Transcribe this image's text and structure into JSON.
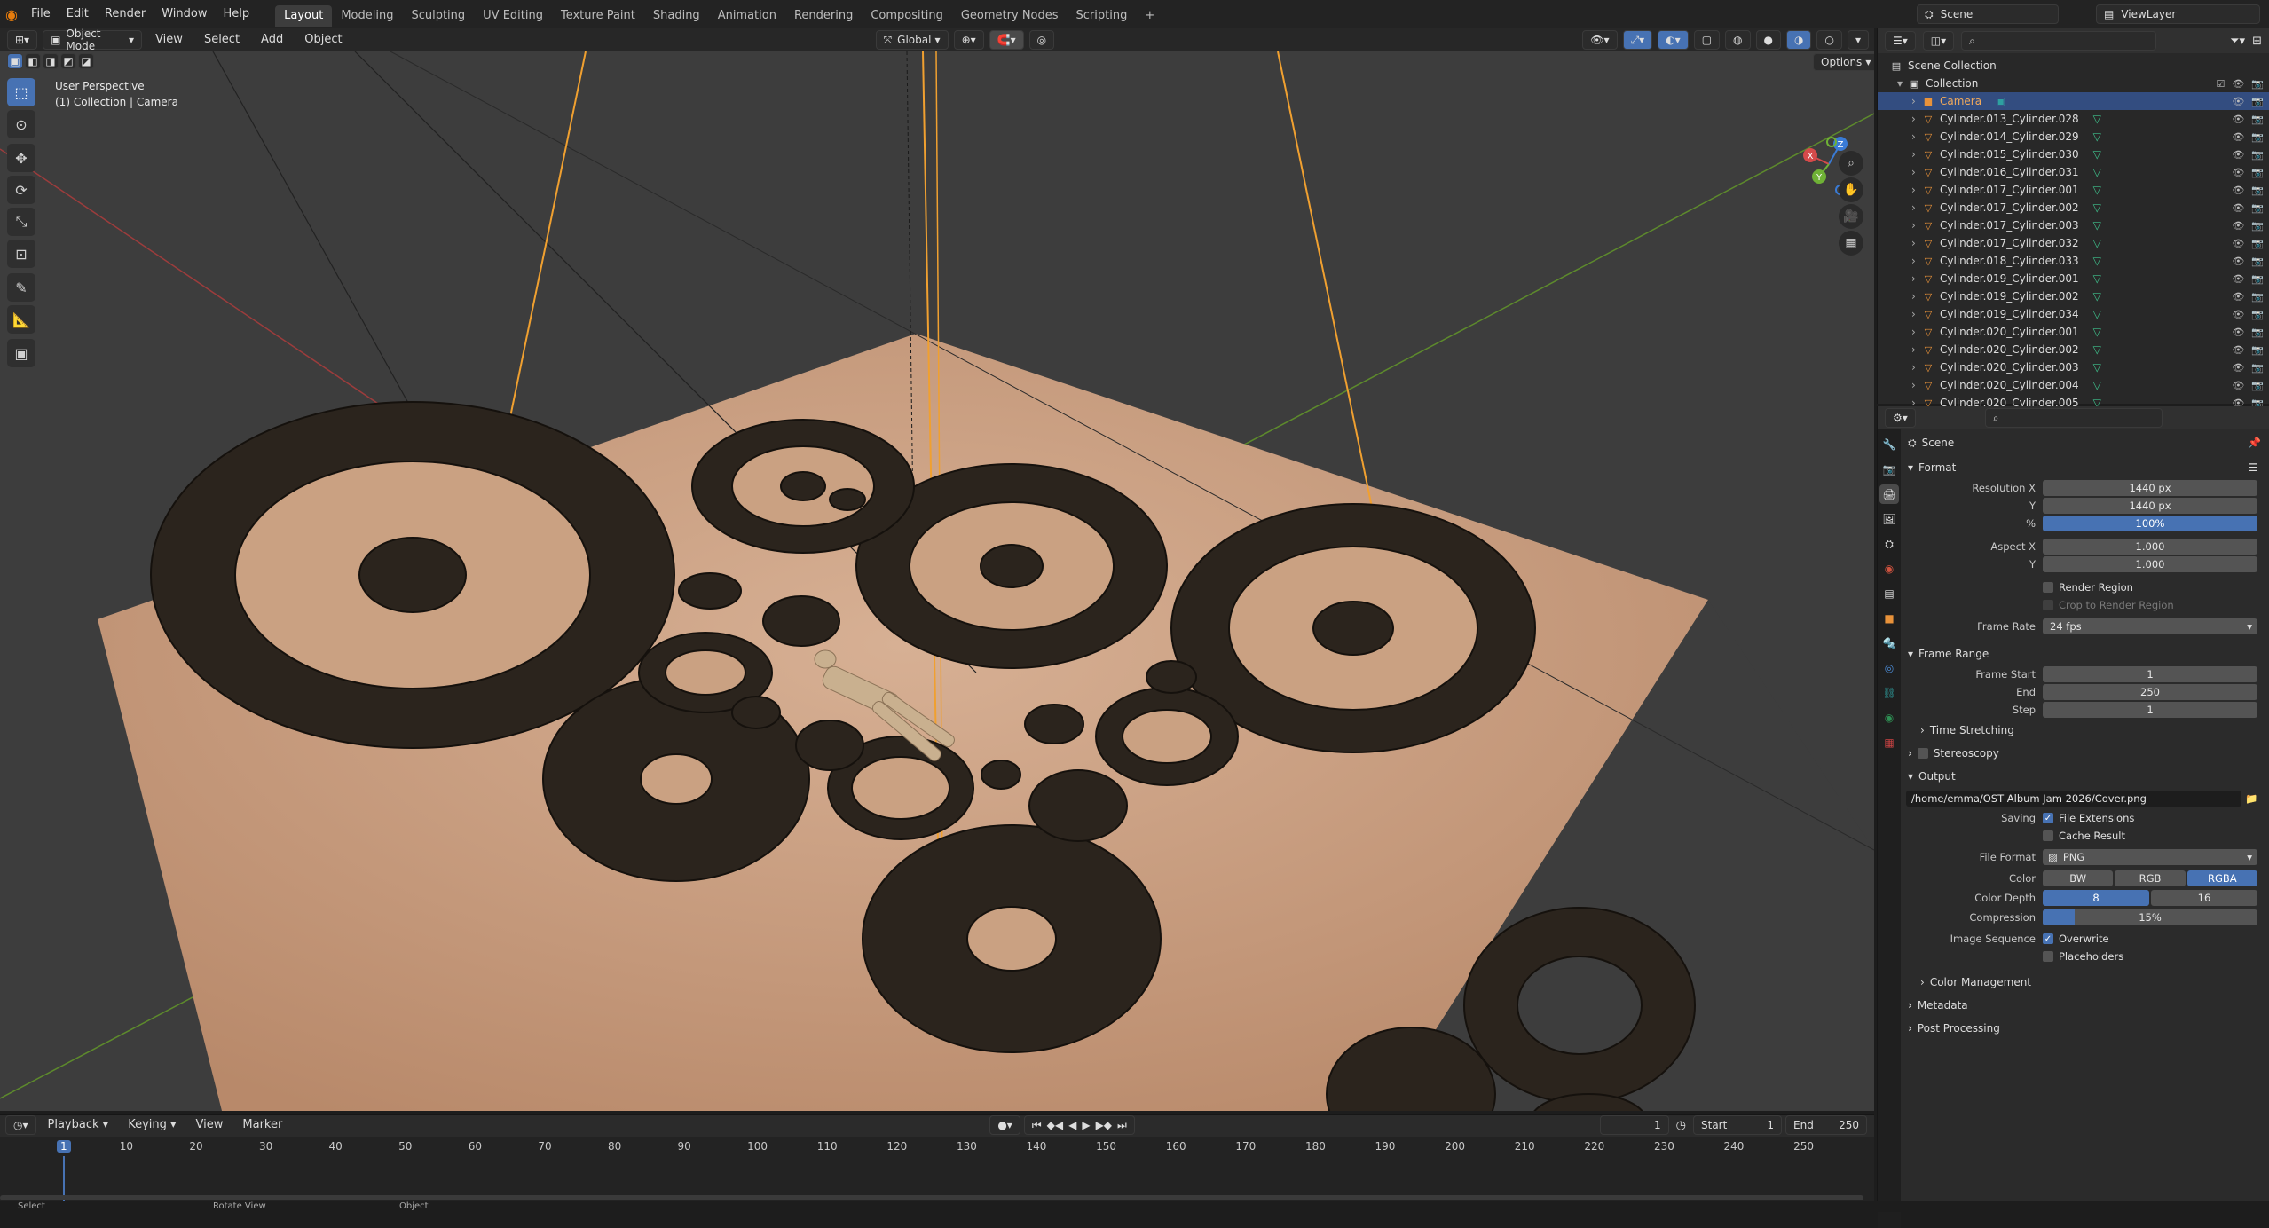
{
  "topbar": {
    "menus": [
      "File",
      "Edit",
      "Render",
      "Window",
      "Help"
    ],
    "workspaces": [
      "Layout",
      "Modeling",
      "Sculpting",
      "UV Editing",
      "Texture Paint",
      "Shading",
      "Animation",
      "Rendering",
      "Compositing",
      "Geometry Nodes",
      "Scripting"
    ],
    "active_workspace": "Layout",
    "scene": "Scene",
    "view_layer": "ViewLayer"
  },
  "viewport_header": {
    "mode": "Object Mode",
    "menus": [
      "View",
      "Select",
      "Add",
      "Object"
    ],
    "transform_orientation": "Global",
    "options_label": "Options"
  },
  "viewport": {
    "perspective": "User Perspective",
    "context": "(1) Collection | Camera",
    "gizmo_axes": [
      "X",
      "Y",
      "Z"
    ],
    "floor_color": "#caa182",
    "gear_color": "#2b241d",
    "accent_line_color": "#f0a030"
  },
  "outliner": {
    "root": "Scene Collection",
    "collection": "Collection",
    "items": [
      "Camera",
      "Cylinder.013_Cylinder.028",
      "Cylinder.014_Cylinder.029",
      "Cylinder.015_Cylinder.030",
      "Cylinder.016_Cylinder.031",
      "Cylinder.017_Cylinder.001",
      "Cylinder.017_Cylinder.002",
      "Cylinder.017_Cylinder.003",
      "Cylinder.017_Cylinder.032",
      "Cylinder.018_Cylinder.033",
      "Cylinder.019_Cylinder.001",
      "Cylinder.019_Cylinder.002",
      "Cylinder.019_Cylinder.034",
      "Cylinder.020_Cylinder.001",
      "Cylinder.020_Cylinder.002",
      "Cylinder.020_Cylinder.003",
      "Cylinder.020_Cylinder.004",
      "Cylinder.020_Cylinder.005"
    ]
  },
  "properties": {
    "context": "Scene",
    "format": {
      "title": "Format",
      "resolution_x_label": "Resolution X",
      "resolution_x": "1440 px",
      "y_label": "Y",
      "resolution_y": "1440 px",
      "pct_label": "%",
      "pct": "100%",
      "aspect_x_label": "Aspect X",
      "aspect_x": "1.000",
      "aspect_y": "1.000",
      "render_region": "Render Region",
      "crop": "Crop to Render Region",
      "frame_rate_label": "Frame Rate",
      "frame_rate": "24 fps"
    },
    "frame_range": {
      "title": "Frame Range",
      "start_label": "Frame Start",
      "start": "1",
      "end_label": "End",
      "end": "250",
      "step_label": "Step",
      "step": "1",
      "time_stretching": "Time Stretching"
    },
    "stereoscopy": "Stereoscopy",
    "output": {
      "title": "Output",
      "path": "/home/emma/OST Album Jam 2026/Cover.png",
      "saving_label": "Saving",
      "file_extensions": "File Extensions",
      "cache_result": "Cache Result",
      "file_format_label": "File Format",
      "file_format": "PNG",
      "color_label": "Color",
      "color_options": [
        "BW",
        "RGB",
        "RGBA"
      ],
      "color_selected": "RGBA",
      "color_depth_label": "Color Depth",
      "depth_options": [
        "8",
        "16"
      ],
      "depth_selected": "8",
      "compression_label": "Compression",
      "compression": "15%",
      "compression_level": 0.15,
      "image_sequence_label": "Image Sequence",
      "overwrite": "Overwrite",
      "placeholders": "Placeholders",
      "color_management": "Color Management"
    },
    "metadata": "Metadata",
    "post_processing": "Post Processing"
  },
  "timeline": {
    "menus": [
      "Playback",
      "Keying",
      "View",
      "Marker"
    ],
    "current_frame": "1",
    "start_label": "Start",
    "start": "1",
    "end_label": "End",
    "end": "250",
    "ticks": [
      "1",
      "10",
      "20",
      "30",
      "40",
      "50",
      "60",
      "70",
      "80",
      "90",
      "100",
      "110",
      "120",
      "130",
      "140",
      "150",
      "160",
      "170",
      "180",
      "190",
      "200",
      "210",
      "220",
      "230",
      "240",
      "250"
    ]
  },
  "statusbar": {
    "items": [
      "Select",
      "Rotate View",
      "Object"
    ]
  }
}
